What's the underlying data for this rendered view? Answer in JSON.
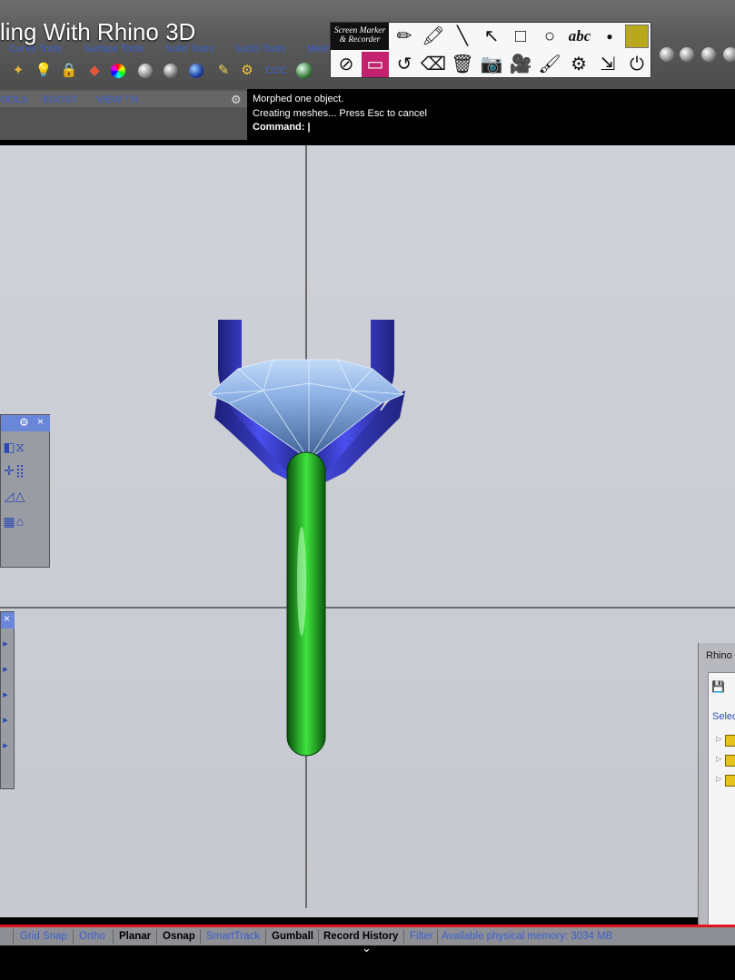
{
  "video": {
    "title": "ling With Rhino 3D"
  },
  "tabs": [
    "Curve Tools",
    "Surface Tools",
    "Solid Tools",
    "SubD Tools",
    "Mesh"
  ],
  "toolbar2": {
    "labels": [
      "OOLS",
      "BOOST",
      "VIEW TN"
    ]
  },
  "toolbar_icons": [
    "layer-icon",
    "light-icon",
    "lock-icon",
    "render-icon",
    "color-wheel-icon",
    "sphere-gray-icon",
    "sphere-gray-icon",
    "sphere-blue-icon",
    "pencil-icon",
    "gear-icon",
    "ccc-icon",
    "environment-icon",
    "sphere-icon"
  ],
  "toolbar_ccc_label": "CCC",
  "screen_marker": {
    "logo_line1": "Screen Marker",
    "logo_line2": "& Recorder",
    "abc_label": "abc",
    "color": "#b8a81a",
    "tools_row1": [
      "pencil-icon",
      "marker-icon",
      "line-icon",
      "arrow-icon",
      "rectangle-icon",
      "circle-icon",
      "text-icon",
      "dot-icon",
      "color-swatch"
    ],
    "tools_row2": [
      "hide-icon",
      "screen-icon",
      "undo-icon",
      "eraser-icon",
      "trash-icon",
      "camera-icon",
      "video-camera-icon",
      "brush-icon",
      "settings-icon",
      "minimize-icon",
      "power-icon"
    ]
  },
  "command": {
    "line1": "Morphed one object.",
    "line2": "Creating meshes... Press Esc to cancel",
    "prompt": "Command:"
  },
  "right_panel": {
    "title": "Rhino",
    "select_label": "Selec"
  },
  "status_bar": {
    "items": [
      {
        "label": "Grid Snap",
        "active": false
      },
      {
        "label": "Ortho",
        "active": false
      },
      {
        "label": "Planar",
        "active": true
      },
      {
        "label": "Osnap",
        "active": true
      },
      {
        "label": "SmartTrack",
        "active": false
      },
      {
        "label": "Gumball",
        "active": true
      },
      {
        "label": "Record History",
        "active": true
      },
      {
        "label": "Filter",
        "active": false
      }
    ],
    "memory": "Available physical memory: 3034 MB"
  },
  "colors": {
    "prong_blue": "#3b3fd0",
    "shank_green": "#1db21d",
    "gem_blue": "#9fc2f0",
    "status_red": "#e0141c"
  }
}
